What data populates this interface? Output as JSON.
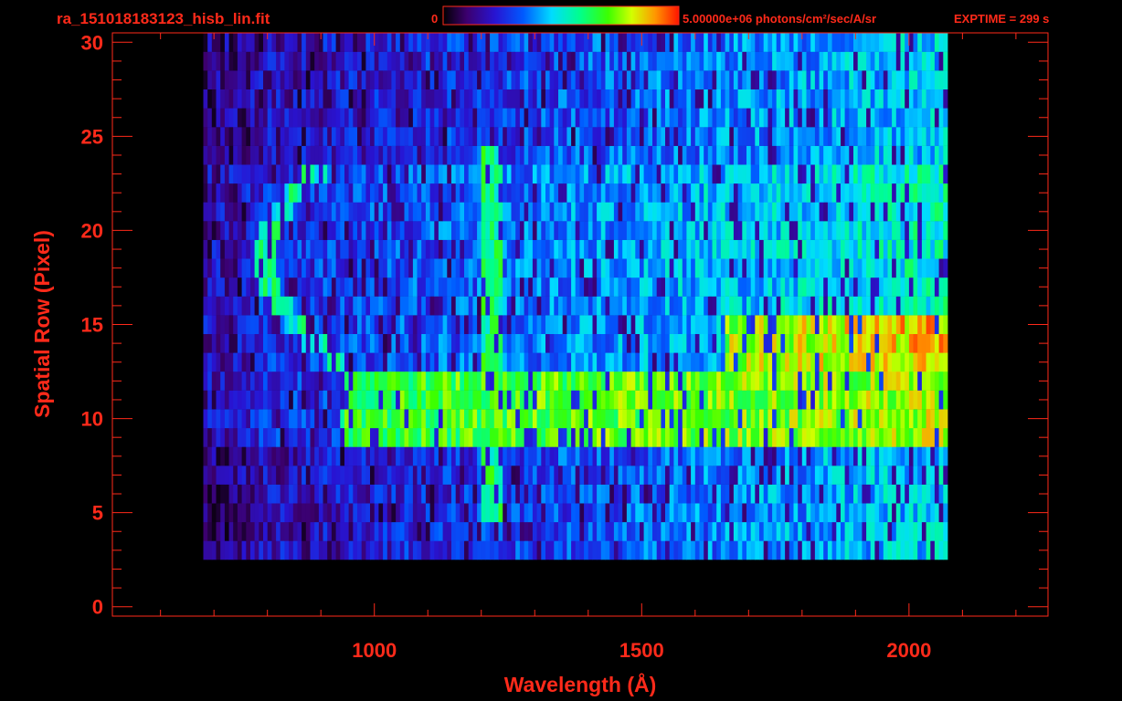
{
  "header": {
    "filename": "ra_151018183123_hisb_lin.fit",
    "colorbar_min": "0",
    "colorbar_max_units": "5.00000e+06 photons/cm²/sec/A/sr",
    "exptime": "EXPTIME = 299 s"
  },
  "colors": {
    "text": "#ff2a1a",
    "frame": "#ff2a1a",
    "background": "#000000"
  },
  "chart_data": {
    "type": "heatmap",
    "colormap": "rainbow",
    "xlabel": "Wavelength (Å)",
    "ylabel": "Spatial Row (Pixel)",
    "xlim": [
      510,
      2260
    ],
    "ylim": [
      -0.5,
      30.5
    ],
    "x_ticks": [
      1000,
      1500,
      2000
    ],
    "y_ticks": [
      0,
      5,
      10,
      15,
      20,
      25,
      30
    ],
    "data_extent_x": [
      680,
      2070
    ],
    "data_extent_rows": [
      3,
      30
    ],
    "color_range": [
      0,
      5000000
    ],
    "features": {
      "continuum_bands": [
        {
          "rows": [
            9,
            12
          ],
          "x": [
            930,
            2065
          ],
          "level": 0.65
        },
        {
          "rows": [
            13,
            15
          ],
          "x": [
            1650,
            2065
          ],
          "level": 0.75
        }
      ],
      "emission_line": {
        "x": 1216,
        "rows": [
          5,
          24
        ],
        "level": 0.5
      },
      "arc_feature": {
        "rows": [
          13,
          23
        ],
        "x_min": 790,
        "x_max": 930,
        "level": 0.45
      }
    }
  }
}
